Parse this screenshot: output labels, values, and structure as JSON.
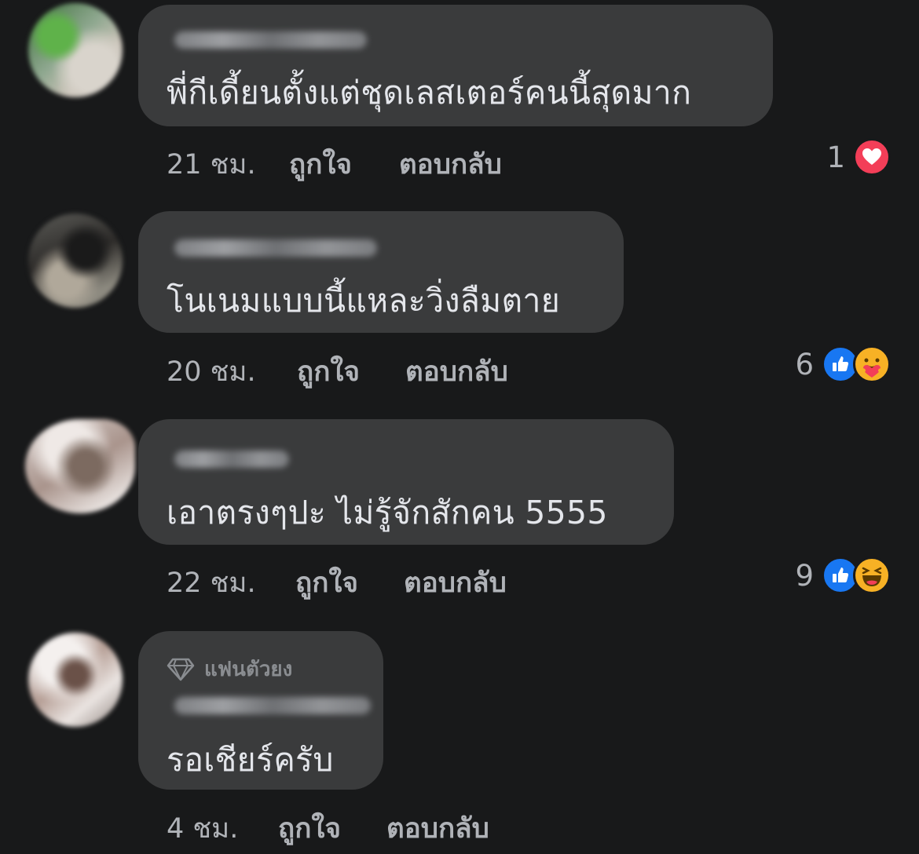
{
  "comments": [
    {
      "text": "พี่กีเดี้ยนตั้งแต่ชุดเลสเตอร์คนนี้สุดมาก",
      "time": "21 ชม.",
      "like_label": "ถูกใจ",
      "reply_label": "ตอบกลับ",
      "reaction_count": "1",
      "reactions": [
        "heart-icon"
      ]
    },
    {
      "text": "โนเนมแบบนี้แหละวิ่งลืมตาย",
      "time": "20 ชม.",
      "like_label": "ถูกใจ",
      "reply_label": "ตอบกลับ",
      "reaction_count": "6",
      "reactions": [
        "like-icon",
        "care-icon"
      ]
    },
    {
      "text": "เอาตรงๆปะ ไม่รู้จักสักคน 5555",
      "time": "22 ชม.",
      "like_label": "ถูกใจ",
      "reply_label": "ตอบกลับ",
      "reaction_count": "9",
      "reactions": [
        "like-icon",
        "haha-icon"
      ]
    },
    {
      "badge": "แฟนตัวยง",
      "text": "รอเชียร์ครับ",
      "time": "4 ชม.",
      "like_label": "ถูกใจ",
      "reply_label": "ตอบกลับ"
    }
  ],
  "colors": {
    "background": "#18191a",
    "bubble": "#3a3b3c",
    "text": "#e4e6eb",
    "meta": "#b0b3b8",
    "like_blue": "#1877f2",
    "love_red": "#f33e58",
    "emoji_yellow": "#f7b125"
  }
}
